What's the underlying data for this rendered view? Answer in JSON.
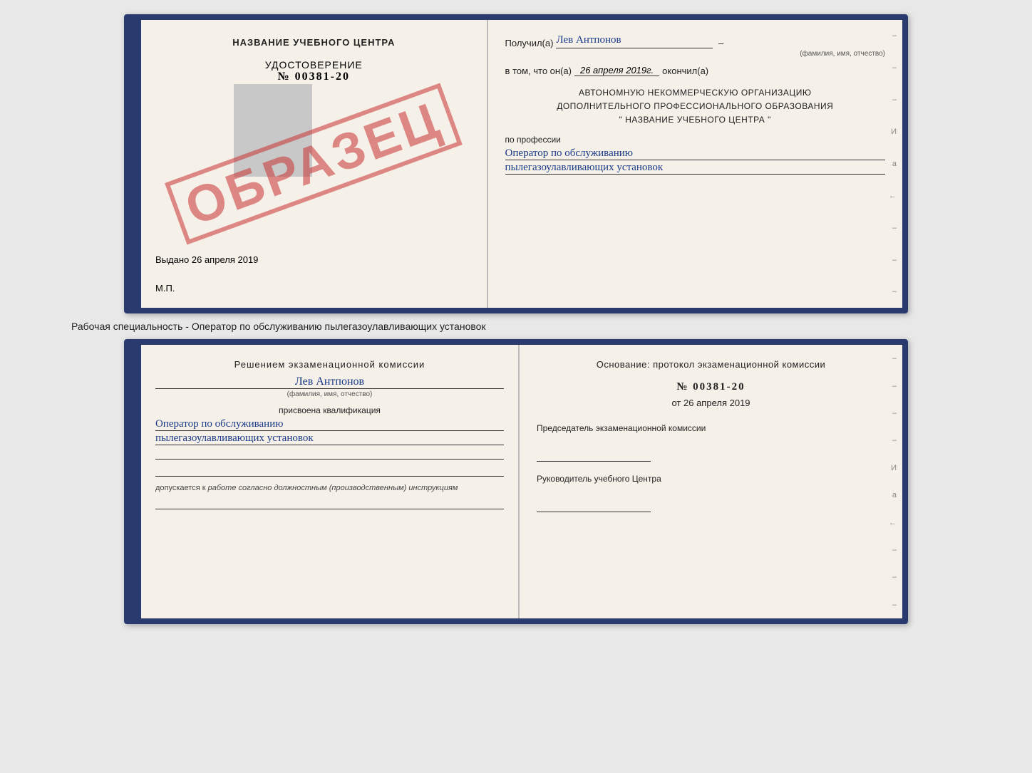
{
  "page": {
    "background_color": "#e8e8e8"
  },
  "top_cert": {
    "left": {
      "center_title": "НАЗВАНИЕ УЧЕБНОГО ЦЕНТРА",
      "cert_label": "УДОСТОВЕРЕНИЕ",
      "cert_number": "№ 00381-20",
      "issued_prefix": "Выдано",
      "issued_date": "26 апреля 2019",
      "mp_label": "М.П."
    },
    "stamp": "ОБРАЗЕЦ",
    "right": {
      "received_prefix": "Получил(а)",
      "recipient_name": "Лев Антпонов",
      "fio_sublabel": "(фамилия, имя, отчество)",
      "in_that_prefix": "в том, что он(а)",
      "completion_date": "26 апреля 2019г.",
      "completed_suffix": "окончил(а)",
      "org_line1": "АВТОНОМНУЮ НЕКОММЕРЧЕСКУЮ ОРГАНИЗАЦИЮ",
      "org_line2": "ДОПОЛНИТЕЛЬНОГО ПРОФЕССИОНАЛЬНОГО ОБРАЗОВАНИЯ",
      "org_line3": "\"   НАЗВАНИЕ УЧЕБНОГО ЦЕНТРА   \"",
      "profession_label": "по профессии",
      "profession_line1": "Оператор по обслуживанию",
      "profession_line2": "пылегазоулавливающих установок",
      "side_marks": [
        "-",
        "-",
        "-",
        "И",
        "а",
        "←",
        "-",
        "-",
        "-"
      ]
    }
  },
  "subtitle": "Рабочая специальность - Оператор по обслуживанию пылегазоулавливающих установок",
  "bottom_cert": {
    "left": {
      "komissia_text": "Решением экзаменационной комиссии",
      "fio_name": "Лев Антпонов",
      "fio_sublabel": "(фамилия, имя, отчество)",
      "assigned_label": "присвоена квалификация",
      "kvalif_line1": "Оператор по обслуживанию",
      "kvalif_line2": "пылегазоулавливающих установок",
      "dopusk_prefix": "допускается к",
      "dopusk_italic": "работе согласно должностным (производственным) инструкциям"
    },
    "right": {
      "osnov_label": "Основание: протокол экзаменационной комиссии",
      "protocol_number": "№ 00381-20",
      "protocol_date_prefix": "от",
      "protocol_date": "26 апреля 2019",
      "chairman_label": "Председатель экзаменационной комиссии",
      "director_label": "Руководитель учебного Центра",
      "side_marks": [
        "-",
        "-",
        "-",
        "-",
        "И",
        "а",
        "←",
        "-",
        "-",
        "-"
      ]
    }
  }
}
